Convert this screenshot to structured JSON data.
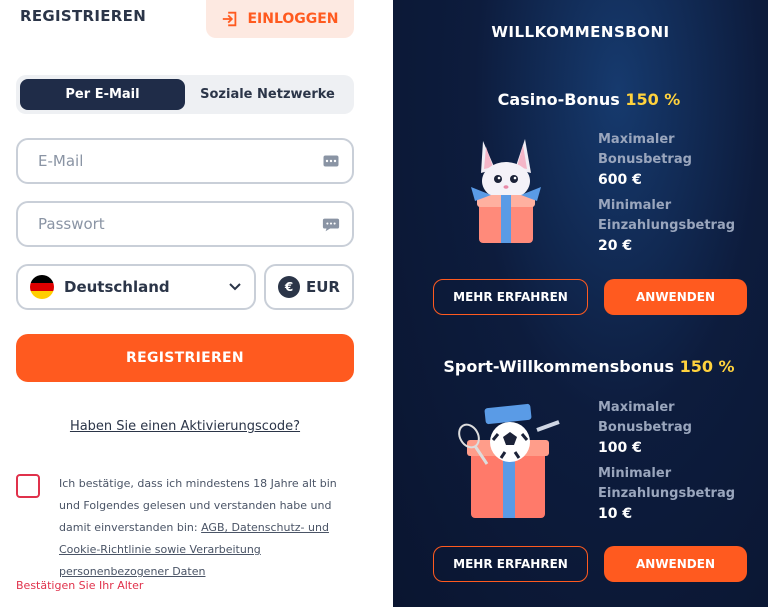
{
  "left": {
    "title": "REGISTRIEREN",
    "login_label": "EINLOGGEN",
    "tabs": [
      {
        "label": "Per E-Mail",
        "active": true
      },
      {
        "label": "Soziale Netzwerke",
        "active": false
      }
    ],
    "email_placeholder": "E-Mail",
    "password_placeholder": "Passwort",
    "country": "Deutschland",
    "currency": "EUR",
    "currency_symbol": "€",
    "register_label": "REGISTRIEREN",
    "activation_link": "Haben Sie einen Aktivierungscode?",
    "consent_prefix": "Ich bestätige, dass ich mindestens 18 Jahre alt bin und Folgendes gelesen und verstanden habe und damit einverstanden bin: ",
    "consent_link": "AGB, Datenschutz- und Cookie-Richtlinie sowie Verarbeitung personenbezogener Daten",
    "age_error": "Bestätigen Sie Ihr Alter"
  },
  "right": {
    "title": "WILLKOMMENSBONI",
    "bonuses": [
      {
        "name": "Casino-Bonus",
        "percent": "150 %",
        "max_label_1": "Maximaler",
        "max_label_2": "Bonusbetrag",
        "max_value": "600 €",
        "min_label_1": "Minimaler",
        "min_label_2": "Einzahlungsbetrag",
        "min_value": "20 €",
        "more_label": "MEHR ERFAHREN",
        "apply_label": "ANWENDEN"
      },
      {
        "name": "Sport-Willkommensbonus",
        "percent": "150 %",
        "max_label_1": "Maximaler",
        "max_label_2": "Bonusbetrag",
        "max_value": "100 €",
        "min_label_1": "Minimaler",
        "min_label_2": "Einzahlungsbetrag",
        "min_value": "10 €",
        "more_label": "MEHR ERFAHREN",
        "apply_label": "ANWENDEN"
      }
    ]
  },
  "colors": {
    "accent": "#ff5a1f",
    "navy": "#1f2c48",
    "highlight": "#ffd23d",
    "error": "#e0314b"
  }
}
